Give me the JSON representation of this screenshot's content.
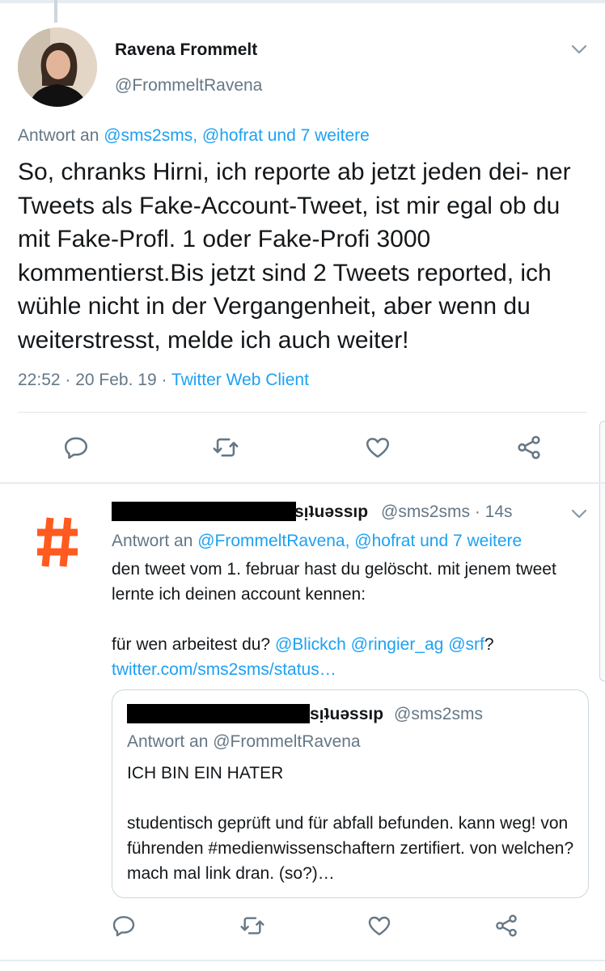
{
  "tweet": {
    "author_name": "Ravena Frommelt",
    "author_handle": "@FrommeltRavena",
    "reply_prefix": "Antwort an",
    "reply_targets": "@sms2sms, @hofrat und 7 weitere",
    "text": "So, chranks Hirni, ich reporte ab jetzt jeden  dei- ner Tweets als Fake-Account-Tweet, ist mir egal ob du mit Fake-Profl. 1 oder Fake-Profi 3000 kommentierst.Bis jetzt sind 2 Tweets  reported, ich wühle nicht in der Vergangenheit, aber wenn du weiterstresst, melde ich auch weiter!",
    "timestamp": "22:52 · 20 Feb. 19 · ",
    "client": "Twitter Web Client"
  },
  "reply": {
    "author_suffix": "sı̣ʇuǝssıp",
    "author_handle": "@sms2sms",
    "age": "· 14s",
    "reply_prefix": "Antwort an",
    "reply_targets": "@FrommeltRavena, @hofrat und 7 weitere",
    "text_line1": "den tweet vom 1. februar hast du gelöscht. mit jenem tweet lernte ich deinen account kennen:",
    "text_line2_prefix": "für wen arbeitest du? ",
    "mention_blick": "@Blickch",
    "mention_ringier": "@ringier_ag",
    "mention_srf": "@srf",
    "question_mark": "?",
    "link": "twitter.com/sms2sms/status…"
  },
  "quote": {
    "author_suffix": "sı̣ʇuǝssıp",
    "author_handle": "@sms2sms",
    "reply_prefix": "Antwort an",
    "reply_target": "@FrommeltRavena",
    "text": "ICH BIN EIN HATER\n\nstudentisch geprüft und für abfall befunden. kann weg! von führenden #medienwissenschaftern zertifiert. von welchen? mach mal link dran. (so?)…"
  },
  "colors": {
    "link": "#1da1f2",
    "muted": "#657786",
    "hashtag_icon": "#ff5a1f"
  }
}
